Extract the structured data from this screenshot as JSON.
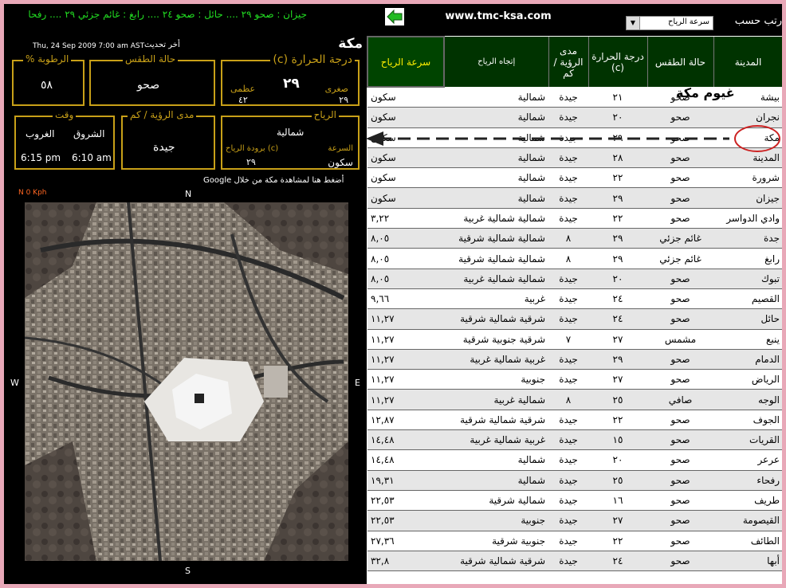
{
  "ticker": "جيزان : صحو ٢٩ .... حائل : صحو ٢٤ .... رابغ : غائم جزئي ٢٩ .... رفحا",
  "site_url": "www.tmc-ksa.com",
  "sort": {
    "label": "رتب حسب",
    "value": "سرعة الرياح"
  },
  "city": {
    "name": "مكة",
    "update_label": "أخر تحديث",
    "update_date": "Thu, 24 Sep 2009 7:00 am AST",
    "temperature": {
      "title": "درجة الحرارة (c)",
      "value": "٢٩",
      "min_label": "صغرى",
      "min": "٢٩",
      "max_label": "عظمى",
      "max": "٤٢"
    },
    "condition": {
      "title": "حالة الطقس",
      "value": "صحو"
    },
    "humidity": {
      "title": "الرطوبة %",
      "value": "٥٨"
    },
    "wind": {
      "title": "الرياح",
      "direction": "شمالية",
      "speed_label": "السرعة",
      "speed": "سكون",
      "chill_label": "برودة الرياح (c)",
      "chill": "٢٩"
    },
    "visibility": {
      "title": "مدى الرؤية / كم",
      "value": "جيدة"
    },
    "time": {
      "title": "وقت",
      "sunrise_label": "الشروق",
      "sunrise": "6:10 am",
      "sunset_label": "الغروب",
      "sunset": "6:15 pm"
    },
    "google_link": "أضغط هنا لمشاهدة مكة من خلال Google",
    "map_speed": "N 0 Kph",
    "compass": {
      "n": "N",
      "s": "S",
      "e": "E",
      "w": "W"
    }
  },
  "annotation": "غيوم مكة",
  "table": {
    "headers": {
      "city": "المدينة",
      "condition": "حالة الطقس",
      "temp": "درجة الحرارة (c)",
      "visibility": "مدى الرؤية / كم",
      "wind_dir": "إتجاه الرياح",
      "wind_speed": "سرعة الرياح"
    },
    "rows": [
      {
        "city": "بيشة",
        "condition": "صحو",
        "temp": "٢١",
        "visibility": "جيدة",
        "wind_dir": "شمالية",
        "wind_speed": "سكون"
      },
      {
        "city": "نجران",
        "condition": "صحو",
        "temp": "٢٠",
        "visibility": "جيدة",
        "wind_dir": "شمالية",
        "wind_speed": "سكون"
      },
      {
        "city": "مكة",
        "condition": "صحو",
        "temp": "٢٩",
        "visibility": "جيدة",
        "wind_dir": "شمالية",
        "wind_speed": "سكون"
      },
      {
        "city": "المدينة",
        "condition": "صحو",
        "temp": "٢٨",
        "visibility": "جيدة",
        "wind_dir": "شمالية",
        "wind_speed": "سكون"
      },
      {
        "city": "شرورة",
        "condition": "صحو",
        "temp": "٢٢",
        "visibility": "جيدة",
        "wind_dir": "شمالية",
        "wind_speed": "سكون"
      },
      {
        "city": "جيزان",
        "condition": "صحو",
        "temp": "٢٩",
        "visibility": "جيدة",
        "wind_dir": "شمالية",
        "wind_speed": "سكون"
      },
      {
        "city": "وادي الدواسر",
        "condition": "صحو",
        "temp": "٢٢",
        "visibility": "جيدة",
        "wind_dir": "شمالية شمالية غربية",
        "wind_speed": "٣,٢٢"
      },
      {
        "city": "جدة",
        "condition": "غائم جزئي",
        "temp": "٢٩",
        "visibility": "٨",
        "wind_dir": "شمالية شمالية شرقية",
        "wind_speed": "٨,٠٥"
      },
      {
        "city": "رابغ",
        "condition": "غائم جزئي",
        "temp": "٢٩",
        "visibility": "٨",
        "wind_dir": "شمالية شمالية شرقية",
        "wind_speed": "٨,٠٥"
      },
      {
        "city": "تبوك",
        "condition": "صحو",
        "temp": "٢٠",
        "visibility": "جيدة",
        "wind_dir": "شمالية شمالية غربية",
        "wind_speed": "٨,٠٥"
      },
      {
        "city": "القصيم",
        "condition": "صحو",
        "temp": "٢٤",
        "visibility": "جيدة",
        "wind_dir": "غربية",
        "wind_speed": "٩,٦٦"
      },
      {
        "city": "حائل",
        "condition": "صحو",
        "temp": "٢٤",
        "visibility": "جيدة",
        "wind_dir": "شرقية شمالية شرقية",
        "wind_speed": "١١,٢٧"
      },
      {
        "city": "ينبع",
        "condition": "مشمس",
        "temp": "٢٧",
        "visibility": "٧",
        "wind_dir": "شرقية جنوبية شرقية",
        "wind_speed": "١١,٢٧"
      },
      {
        "city": "الدمام",
        "condition": "صحو",
        "temp": "٢٩",
        "visibility": "جيدة",
        "wind_dir": "غربية شمالية غربية",
        "wind_speed": "١١,٢٧"
      },
      {
        "city": "الرياض",
        "condition": "صحو",
        "temp": "٢٧",
        "visibility": "جيدة",
        "wind_dir": "جنوبية",
        "wind_speed": "١١,٢٧"
      },
      {
        "city": "الوجه",
        "condition": "صافي",
        "temp": "٢٥",
        "visibility": "٨",
        "wind_dir": "شمالية غربية",
        "wind_speed": "١١,٢٧"
      },
      {
        "city": "الجوف",
        "condition": "صحو",
        "temp": "٢٢",
        "visibility": "جيدة",
        "wind_dir": "شرقية شمالية شرقية",
        "wind_speed": "١٢,٨٧"
      },
      {
        "city": "القريات",
        "condition": "صحو",
        "temp": "١٥",
        "visibility": "جيدة",
        "wind_dir": "غربية شمالية غربية",
        "wind_speed": "١٤,٤٨"
      },
      {
        "city": "عرعر",
        "condition": "صحو",
        "temp": "٢٠",
        "visibility": "جيدة",
        "wind_dir": "شمالية",
        "wind_speed": "١٤,٤٨"
      },
      {
        "city": "رفحاء",
        "condition": "صحو",
        "temp": "٢٥",
        "visibility": "جيدة",
        "wind_dir": "شمالية",
        "wind_speed": "١٩,٣١"
      },
      {
        "city": "طريف",
        "condition": "صحو",
        "temp": "١٦",
        "visibility": "جيدة",
        "wind_dir": "شمالية شرقية",
        "wind_speed": "٢٢,٥٣"
      },
      {
        "city": "القيصومة",
        "condition": "صحو",
        "temp": "٢٧",
        "visibility": "جيدة",
        "wind_dir": "جنوبية",
        "wind_speed": "٢٢,٥٣"
      },
      {
        "city": "الطائف",
        "condition": "صحو",
        "temp": "٢٢",
        "visibility": "جيدة",
        "wind_dir": "جنوبية شرقية",
        "wind_speed": "٢٧,٣٦"
      },
      {
        "city": "أبها",
        "condition": "صحو",
        "temp": "٢٤",
        "visibility": "جيدة",
        "wind_dir": "شرقية شمالية شرقية",
        "wind_speed": "٣٢,٨"
      }
    ]
  },
  "colors": {
    "accent": "#c8a018",
    "header_bg": "#003300",
    "ticker": "#22dd22",
    "wind_header": "#ffee00",
    "highlight": "#cc2222"
  }
}
